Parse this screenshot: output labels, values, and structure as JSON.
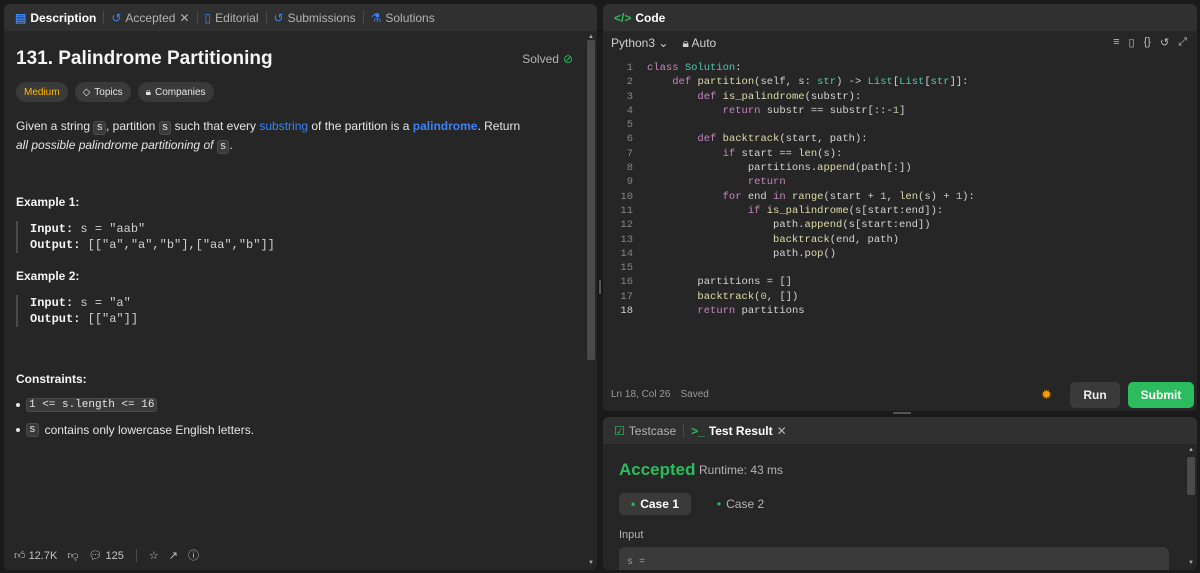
{
  "left_tabs": [
    {
      "label": "Description",
      "icon": "document-icon"
    },
    {
      "label": "Accepted",
      "icon": "history-icon"
    },
    {
      "label": "Editorial",
      "icon": "book-icon"
    },
    {
      "label": "Submissions",
      "icon": "clock-icon"
    },
    {
      "label": "Solutions",
      "icon": "flask-icon"
    }
  ],
  "problem": {
    "title": "131. Palindrome Partitioning",
    "solved_label": "Solved",
    "difficulty": "Medium",
    "topics_label": "Topics",
    "companies_label": "Companies",
    "desc_1": "Given a string ",
    "var_s": "s",
    "desc_2": ", partition ",
    "desc_3": " such that every ",
    "substring_link": "substring",
    "desc_4": " of the partition is a ",
    "palindrome_link": "palindrome",
    "desc_5": ". Return ",
    "desc_6": "all possible palindrome partitioning of ",
    "desc_7": "."
  },
  "examples": [
    {
      "heading": "Example 1:",
      "input_label": "Input:",
      "input_value": "s = \"aab\"",
      "output_label": "Output:",
      "output_value": "[[\"a\",\"a\",\"b\"],[\"aa\",\"b\"]]"
    },
    {
      "heading": "Example 2:",
      "input_label": "Input:",
      "input_value": "s = \"a\"",
      "output_label": "Output:",
      "output_value": "[[\"a\"]]"
    }
  ],
  "constraints": {
    "heading": "Constraints:",
    "c1_code": "1 <= s.length <= 16",
    "c2_code": "s",
    "c2_text": "contains only lowercase English letters."
  },
  "footer": {
    "likes": "12.7K",
    "comments": "125"
  },
  "code_pane": {
    "title": "Code",
    "language": "Python3",
    "mode": "Auto",
    "status_pos": "Ln 18, Col 26",
    "status_saved": "Saved",
    "run_label": "Run",
    "submit_label": "Submit"
  },
  "code_lines": [
    "1",
    "2",
    "3",
    "4",
    "5",
    "6",
    "7",
    "8",
    "9",
    "10",
    "11",
    "12",
    "13",
    "14",
    "15",
    "16",
    "17",
    "18"
  ],
  "result_pane": {
    "testcase_label": "Testcase",
    "testresult_label": "Test Result",
    "verdict": "Accepted",
    "runtime": "Runtime: 43 ms",
    "case1": "Case 1",
    "case2": "Case 2",
    "input_label": "Input",
    "input_value": "s ="
  },
  "colors": {
    "accent_blue": "#3b82f6",
    "accepted_green": "#2cbb5d",
    "medium_yellow": "#ffb800"
  }
}
